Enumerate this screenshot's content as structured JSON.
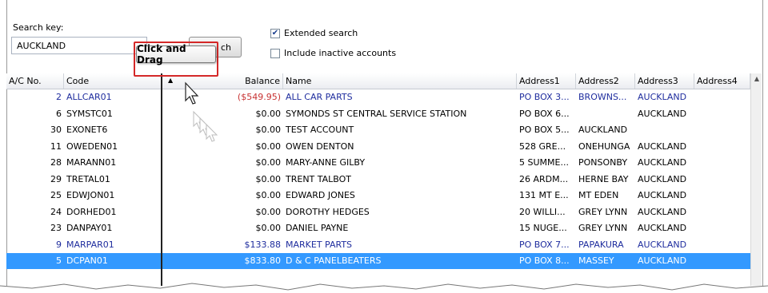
{
  "search": {
    "label": "Search key:",
    "value": "AUCKLAND",
    "button_label": "ch"
  },
  "options": {
    "extended_search": {
      "label": "Extended search",
      "checked": true
    },
    "include_inactive": {
      "label": "Include inactive accounts",
      "checked": false
    }
  },
  "callout": {
    "text": "Click and Drag"
  },
  "columns": [
    "A/C No.",
    "Code",
    "Balance",
    "Name",
    "Address1",
    "Address2",
    "Address3",
    "Address4"
  ],
  "rows": [
    {
      "ac": "2",
      "code": "ALLCAR01",
      "balance": "($549.95)",
      "name": "ALL CAR PARTS",
      "addr1": "PO BOX 3...",
      "addr2": "BROWNS...",
      "addr3": "AUCKLAND",
      "addr4": "",
      "style": "blue",
      "balance_style": "red"
    },
    {
      "ac": "6",
      "code": "SYMSTC01",
      "balance": "$0.00",
      "name": "SYMONDS ST CENTRAL SERVICE STATION",
      "addr1": "PO BOX 6...",
      "addr2": "",
      "addr3": "AUCKLAND",
      "addr4": "",
      "style": "",
      "balance_style": ""
    },
    {
      "ac": "30",
      "code": "EXONET6",
      "balance": "$0.00",
      "name": "TEST ACCOUNT",
      "addr1": "PO BOX 5...",
      "addr2": "AUCKLAND",
      "addr3": "",
      "addr4": "",
      "style": "",
      "balance_style": ""
    },
    {
      "ac": "11",
      "code": "OWEDEN01",
      "balance": "$0.00",
      "name": "OWEN DENTON",
      "addr1": "528 GRE...",
      "addr2": "ONEHUNGA",
      "addr3": "AUCKLAND",
      "addr4": "",
      "style": "",
      "balance_style": ""
    },
    {
      "ac": "28",
      "code": "MARANN01",
      "balance": "$0.00",
      "name": "MARY-ANNE GILBY",
      "addr1": "5 SUMME...",
      "addr2": "PONSONBY",
      "addr3": "AUCKLAND",
      "addr4": "",
      "style": "",
      "balance_style": ""
    },
    {
      "ac": "29",
      "code": "TRETAL01",
      "balance": "$0.00",
      "name": "TRENT TALBOT",
      "addr1": "26 ARDM...",
      "addr2": "HERNE BAY",
      "addr3": "AUCKLAND",
      "addr4": "",
      "style": "",
      "balance_style": ""
    },
    {
      "ac": "25",
      "code": "EDWJON01",
      "balance": "$0.00",
      "name": "EDWARD JONES",
      "addr1": "131 MT E...",
      "addr2": "MT EDEN",
      "addr3": "AUCKLAND",
      "addr4": "",
      "style": "",
      "balance_style": ""
    },
    {
      "ac": "24",
      "code": "DORHED01",
      "balance": "$0.00",
      "name": "DOROTHY HEDGES",
      "addr1": "20 WILLI...",
      "addr2": "GREY LYNN",
      "addr3": "AUCKLAND",
      "addr4": "",
      "style": "",
      "balance_style": ""
    },
    {
      "ac": "23",
      "code": "DANPAY01",
      "balance": "$0.00",
      "name": "DANIEL PAYNE",
      "addr1": "15 NUGE...",
      "addr2": "GREY LYNN",
      "addr3": "AUCKLAND",
      "addr4": "",
      "style": "",
      "balance_style": ""
    },
    {
      "ac": "9",
      "code": "MARPAR01",
      "balance": "$133.88",
      "name": "MARKET PARTS",
      "addr1": "PO BOX 7...",
      "addr2": "PAPAKURA",
      "addr3": "AUCKLAND",
      "addr4": "",
      "style": "blue",
      "balance_style": ""
    },
    {
      "ac": "5",
      "code": "DCPAN01",
      "balance": "$833.80",
      "name": "D & C PANELBEATERS",
      "addr1": "PO BOX 8...",
      "addr2": "MASSEY",
      "addr3": "AUCKLAND",
      "addr4": "",
      "style": "selected",
      "balance_style": ""
    }
  ],
  "colors": {
    "link_blue": "#1f2d9e",
    "negative_red": "#c83232",
    "selection": "#3399ff",
    "callout_border": "#d42828"
  },
  "icons": {
    "sort": "sort-asc-icon",
    "cursor": "drag-cursor-icon",
    "check": "checkmark-icon",
    "scroll_up": "scroll-up-icon"
  }
}
